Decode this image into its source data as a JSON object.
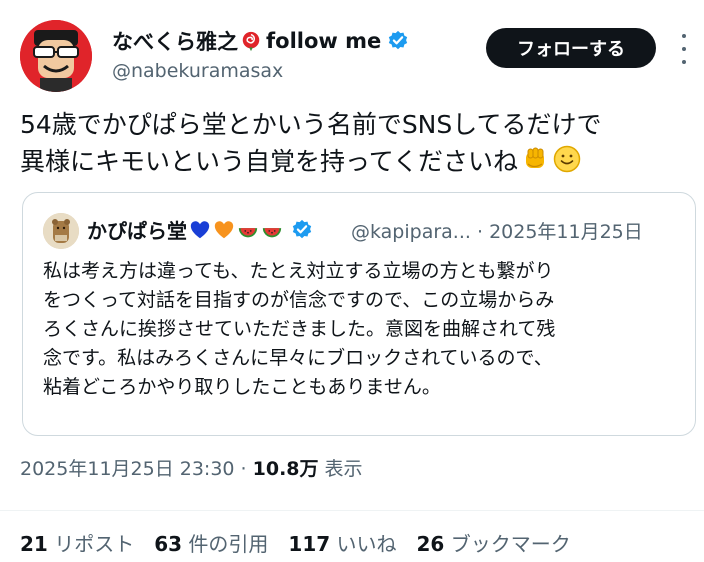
{
  "author": {
    "display_name": "なべくら雅之",
    "display_suffix": "follow me",
    "handle": "@nabekuramasax",
    "icons": [
      "rose-icon",
      "verified-badge-icon"
    ]
  },
  "actions": {
    "follow_label": "フォローする",
    "more_icon": "more-options-icon"
  },
  "tweet": {
    "lines": [
      "54歳でかぴぱら堂とかいう名前でSNSしてるだけで",
      "異様にキモいという自覚を持ってくださいね"
    ],
    "emojis": [
      "raised-fist-emoji",
      "smiling-face-emoji"
    ]
  },
  "quote": {
    "display_name": "かぴぱら堂",
    "emojis": [
      "blue-heart-emoji",
      "orange-heart-emoji",
      "watermelon-emoji",
      "watermelon-emoji"
    ],
    "handle": "@kapipara...",
    "date": "· 2025年11月25日",
    "lines": [
      "私は考え方は違っても、たとえ対立する立場の方とも繋がり",
      "をつくって対話を目指すのが信念ですので、この立場からみ",
      "ろくさんに挨拶させていただきました。意図を曲解されて残",
      "念です。私はみろくさんに早々にブロックされているので、",
      "粘着どころかやり取りしたこともありません。"
    ]
  },
  "meta": {
    "timestamp": "2025年11月25日 23:30 · ",
    "views_count": "10.8万",
    "views_label": " 表示"
  },
  "stats": [
    {
      "count": "21",
      "label": "リポスト"
    },
    {
      "count": "63",
      "label": "件の引用"
    },
    {
      "count": "117",
      "label": "いいね"
    },
    {
      "count": "26",
      "label": "ブックマーク"
    }
  ],
  "colors": {
    "text": "#0f1419",
    "secondary": "#536471",
    "verified": "#1d9bf0",
    "border": "#cfd9de",
    "follow_bg": "#0f1419"
  }
}
